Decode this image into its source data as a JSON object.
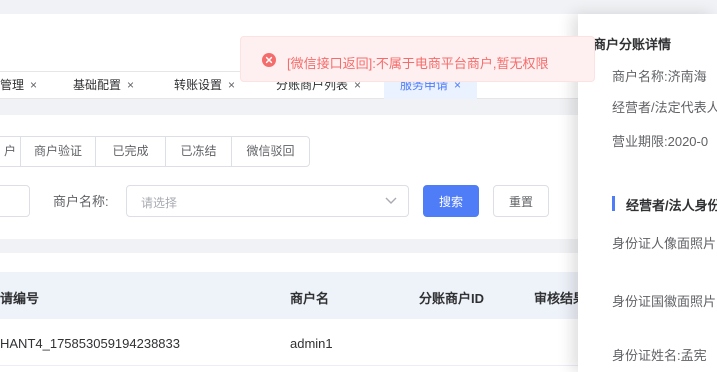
{
  "tabs": [
    {
      "label": "管理",
      "close": "×"
    },
    {
      "label": "基础配置",
      "close": "×"
    },
    {
      "label": "转账设置",
      "close": "×"
    },
    {
      "label": "分账商户列表",
      "close": "×"
    },
    {
      "label": "服务申请",
      "close": "×",
      "active": true
    }
  ],
  "status_filters": [
    "户",
    "商户验证",
    "已完成",
    "已冻结",
    "微信驳回"
  ],
  "search": {
    "merchant_label": "商户名称:",
    "merchant_placeholder": "请选择",
    "search_button": "搜索",
    "reset_button": "重置"
  },
  "table": {
    "columns": [
      "请编号",
      "商户名",
      "分账商户ID",
      "审核结果"
    ],
    "rows": [
      {
        "application_no": "HANT4_175853059194238833",
        "merchant_name": "admin1"
      }
    ]
  },
  "drawer": {
    "title": "商户分账详情",
    "fields": [
      "商户名称:济南海",
      "经营者/法定代表人",
      "营业期限:2020-0"
    ],
    "section_title": "经营者/法人身份",
    "id_fields": [
      "身份证人像面照片",
      "身份证国徽面照片",
      "身份证姓名:孟宪"
    ]
  },
  "toast": {
    "message": "[微信接口返回]:不属于电商平台商户,暂无权限",
    "type": "error"
  },
  "colors": {
    "primary": "#4f7cf7",
    "error": "#f56c6c",
    "error_bg": "#fef0f0"
  }
}
